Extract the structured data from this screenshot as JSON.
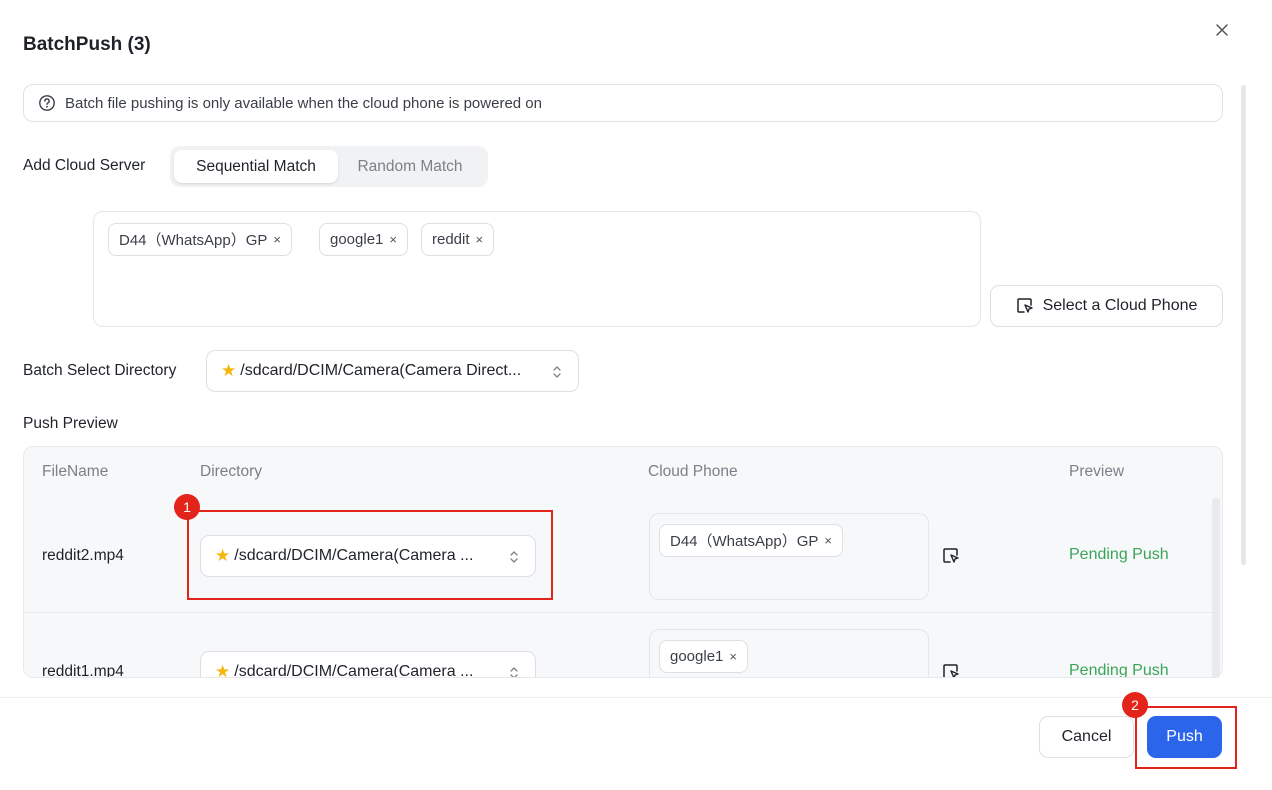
{
  "dialog": {
    "title": "BatchPush (3)",
    "notice": "Batch file pushing is only available when the cloud phone is powered on"
  },
  "add_cloud_server": {
    "label": "Add Cloud Server",
    "modes": [
      "Sequential Match",
      "Random Match"
    ],
    "selected_mode": "Sequential Match",
    "tags": [
      "D44（WhatsApp）GP",
      "google1",
      "reddit"
    ],
    "select_button": "Select a Cloud Phone"
  },
  "batch_directory": {
    "label": "Batch Select Directory",
    "value": "/sdcard/DCIM/Camera(Camera Direct..."
  },
  "push_preview": {
    "label": "Push Preview",
    "columns": [
      "FileName",
      "Directory",
      "Cloud Phone",
      "Preview"
    ],
    "rows": [
      {
        "file": "reddit2.mp4",
        "directory": "/sdcard/DCIM/Camera(Camera ...",
        "phone": "D44（WhatsApp）GP",
        "status": "Pending Push"
      },
      {
        "file": "reddit1.mp4",
        "directory": "/sdcard/DCIM/Camera(Camera ...",
        "phone": "google1",
        "status": "Pending Push"
      }
    ]
  },
  "footer": {
    "cancel": "Cancel",
    "push": "Push"
  },
  "annotations": {
    "marker1": "1",
    "marker2": "2"
  },
  "tag_close_glyph": "×",
  "colors": {
    "primary": "#2b66ea",
    "status_pending": "#3aa55a",
    "annotation": "#e3241b",
    "star": "#f5b50a"
  },
  "icons": {
    "close": "close-icon",
    "help": "question-circle-icon",
    "select_phone": "cursor-select-icon",
    "chevron": "chevron-up-down-icon",
    "star": "star-icon"
  }
}
